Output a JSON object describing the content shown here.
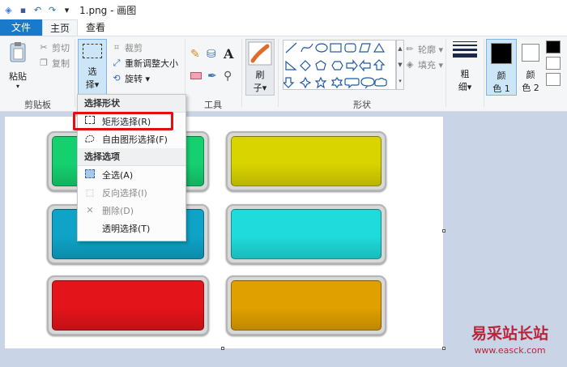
{
  "titlebar": {
    "title": "1.png - 画图",
    "undo_glyph": "↶",
    "redo_glyph": "↷",
    "dropdown_glyph": "▾"
  },
  "tabs": [
    {
      "label": "文件"
    },
    {
      "label": "主页"
    },
    {
      "label": "查看"
    }
  ],
  "ribbon": {
    "clipboard": {
      "paste": "粘贴",
      "cut": "剪切",
      "copy": "复制",
      "label": "剪贴板"
    },
    "image": {
      "select_line1": "选",
      "select_line2": "择▾",
      "crop": "裁剪",
      "resize": "重新调整大小",
      "rotate": "旋转 ▾"
    },
    "tools": {
      "label": "工具",
      "text_tool": "A"
    },
    "brush": {
      "line1": "刷",
      "line2": "子▾"
    },
    "shapes": {
      "label": "形状",
      "outline": "轮廓 ▾",
      "fill": "填充 ▾"
    },
    "size": {
      "line1": "粗",
      "line2": "细▾"
    },
    "color1": {
      "line1": "颜",
      "line2": "色 1"
    },
    "color2": {
      "line1": "颜",
      "line2": "色 2"
    }
  },
  "menu": {
    "section1": "选择形状",
    "rect_select": "矩形选择(R)",
    "free_select": "自由图形选择(F)",
    "section2": "选择选项",
    "select_all": "全选(A)",
    "invert": "反向选择(I)",
    "delete": "删除(D)",
    "transparent": "透明选择(T)"
  },
  "canvas": {
    "button_colors": [
      "#16d070",
      "#d9d400",
      "#0ea3c7",
      "#1fdbdb",
      "#e3141a",
      "#e0a000"
    ]
  },
  "watermark": {
    "line1": "易采站长站",
    "line2": "www.easck.com"
  }
}
